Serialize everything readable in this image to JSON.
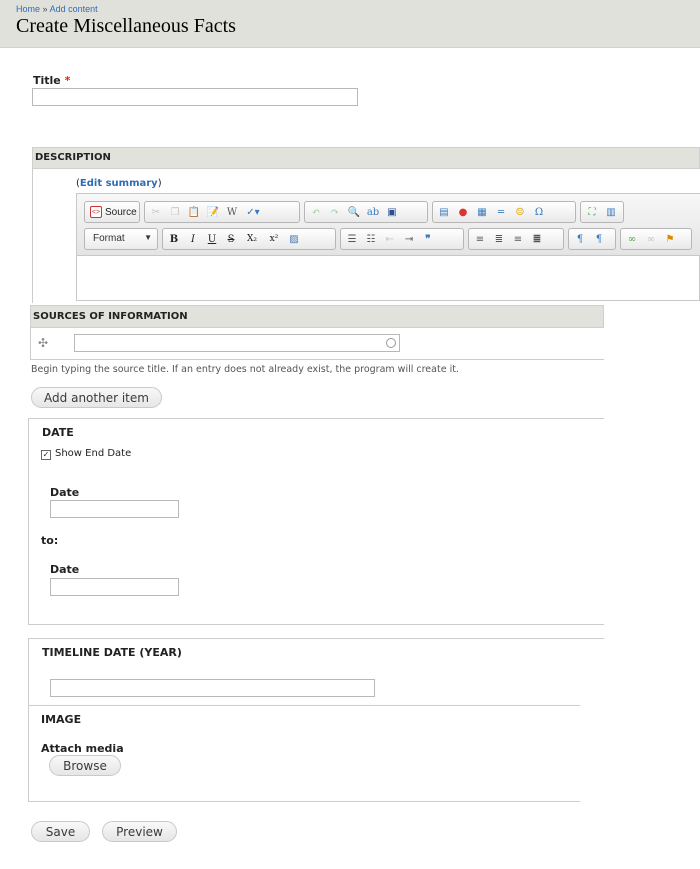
{
  "breadcrumb": {
    "home": "Home",
    "separator": "»",
    "add_content": "Add content"
  },
  "page_title": "Create Miscellaneous Facts",
  "title_field": {
    "label": "Title",
    "required_mark": "*",
    "value": ""
  },
  "description": {
    "section_title": "DESCRIPTION",
    "edit_summary_open": "(",
    "edit_summary_link": "Edit summary",
    "edit_summary_close": ")",
    "toolbar": {
      "source_label": "Source",
      "format_label": "Format",
      "row1_icons": [
        "cut-icon",
        "copy-icon",
        "paste-icon",
        "paste-text-icon",
        "paste-word-icon",
        "spellcheck-icon",
        "undo-icon",
        "redo-icon",
        "find-icon",
        "replace-icon",
        "select-all-icon",
        "image-icon",
        "flash-icon",
        "table-icon",
        "horizontal-rule-icon",
        "smiley-icon",
        "special-char-icon",
        "maximize-icon",
        "show-blocks-icon"
      ],
      "row2_icons": [
        "bold-icon",
        "italic-icon",
        "underline-icon",
        "strike-icon",
        "subscript-icon",
        "superscript-icon",
        "remove-format-icon",
        "numbered-list-icon",
        "bulleted-list-icon",
        "outdent-icon",
        "indent-icon",
        "blockquote-icon",
        "align-left-icon",
        "align-center-icon",
        "align-right-icon",
        "justify-icon",
        "ltr-icon",
        "rtl-icon",
        "link-icon",
        "unlink-icon",
        "anchor-icon"
      ],
      "bold": "B",
      "italic": "I",
      "underline": "U",
      "strike": "S",
      "subscript": "X₂",
      "superscript": "x²"
    }
  },
  "sources": {
    "section_title": "SOURCES OF INFORMATION",
    "value": "",
    "helper_text": "Begin typing the source title. If an entry does not already exist, the program will create it.",
    "add_another_label": "Add another item"
  },
  "date": {
    "section_title": "DATE",
    "show_end_date_label": "Show End Date",
    "show_end_date_checked": true,
    "start_label": "Date",
    "to_label": "to:",
    "end_label": "Date",
    "start_value": "",
    "end_value": ""
  },
  "timeline": {
    "section_title": "TIMELINE DATE (YEAR)",
    "value": ""
  },
  "image": {
    "section_title": "IMAGE",
    "attach_label": "Attach media",
    "browse_label": "Browse"
  },
  "actions": {
    "save_label": "Save",
    "preview_label": "Preview"
  },
  "colors": {
    "header_bg": "#e1e1dc",
    "link": "#2e6db4",
    "required": "#e32700",
    "section_bar": "#e1e2dc"
  }
}
